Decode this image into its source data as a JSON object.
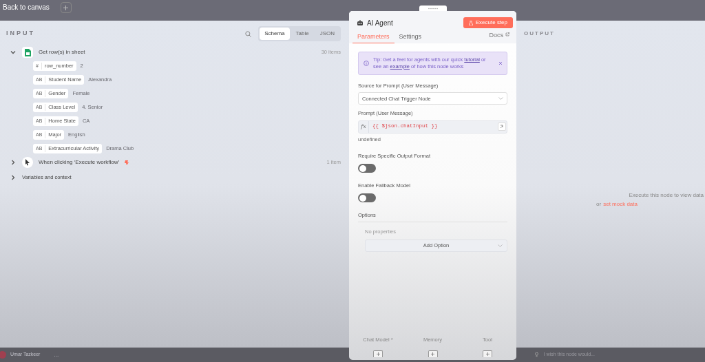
{
  "top_bar": {
    "back_label": "Back to canvas"
  },
  "input": {
    "title": "INPUT",
    "view_tabs": [
      {
        "label": "Schema",
        "selected": true
      },
      {
        "label": "Table",
        "selected": false
      },
      {
        "label": "JSON",
        "selected": false
      }
    ],
    "nodes": [
      {
        "label": "Get row(s) in sheet",
        "count": "30 items",
        "expanded": true,
        "kind": "sheet",
        "pinned": false,
        "fields": [
          {
            "type": "#",
            "name": "row_number",
            "value": "2"
          },
          {
            "type": "AB",
            "name": "Student Name",
            "value": "Alexandra"
          },
          {
            "type": "AB",
            "name": "Gender",
            "value": "Female"
          },
          {
            "type": "AB",
            "name": "Class Level",
            "value": "4. Senior"
          },
          {
            "type": "AB",
            "name": "Home State",
            "value": "CA"
          },
          {
            "type": "AB",
            "name": "Major",
            "value": "English"
          },
          {
            "type": "AB",
            "name": "Extracurricular Activity",
            "value": "Drama Club"
          }
        ]
      },
      {
        "label": "When clicking ‘Execute workflow’",
        "count": "1 item",
        "expanded": false,
        "kind": "pointer",
        "pinned": true
      }
    ],
    "variables": {
      "label": "Variables and context",
      "expanded": false
    }
  },
  "node_panel": {
    "title": "AI Agent",
    "execute_label": "Execute step",
    "tabs": [
      {
        "label": "Parameters",
        "selected": true
      },
      {
        "label": "Settings",
        "selected": false
      }
    ],
    "docs_label": "Docs",
    "tip": [
      {
        "kind": "text",
        "text": "Tip: Get a feel for agents with our quick "
      },
      {
        "kind": "link",
        "text": "tutorial"
      },
      {
        "kind": "text",
        "text": " or see an "
      },
      {
        "kind": "link",
        "text": "example"
      },
      {
        "kind": "text",
        "text": " of how this node works"
      }
    ],
    "source": {
      "label": "Source for Prompt (User Message)",
      "value": "Connected Chat Trigger Node"
    },
    "prompt": {
      "label": "Prompt (User Message)",
      "fx": "fx",
      "value": "{{ $json.chatInput }}",
      "hint": "undefined"
    },
    "toggles": [
      {
        "label": "Require Specific Output Format",
        "on": false
      },
      {
        "label": "Enable Fallback Model",
        "on": false
      }
    ],
    "options": {
      "title": "Options",
      "empty": "No properties",
      "add_label": "Add Option"
    },
    "connectors": [
      "Chat Model *",
      "Memory",
      "Tool"
    ]
  },
  "output": {
    "title": "OUTPUT",
    "message": "Execute this node to view data",
    "or": "or",
    "link": "set mock data"
  },
  "bottom_bar": {
    "user": "Umar Tazkeer",
    "more": "...",
    "feedback": "I wish this node would..."
  }
}
